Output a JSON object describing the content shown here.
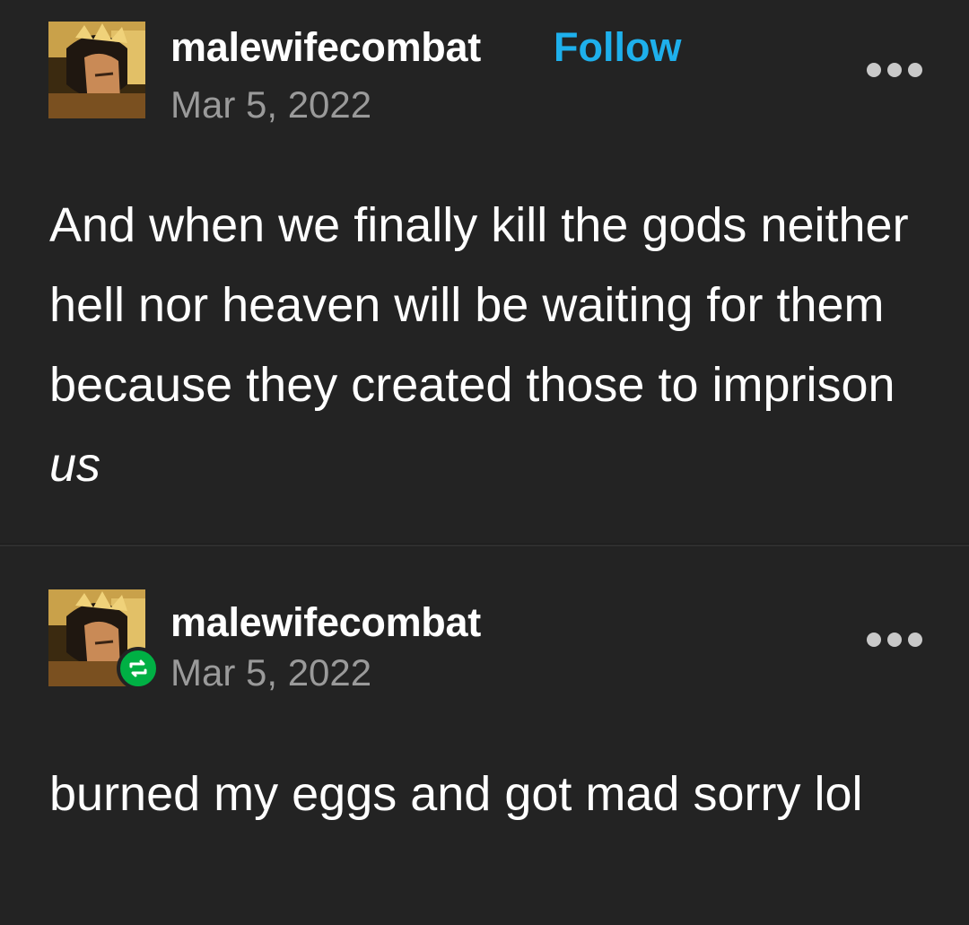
{
  "posts": [
    {
      "username": "malewifecombat",
      "follow_label": "Follow",
      "date": "Mar 5, 2022",
      "text_plain": "And when we finally kill the gods neither hell nor heaven will be waiting for them because they created those to imprison",
      "text_emphasis": "us",
      "avatar_icon": "avatar-image",
      "more_icon": "more-options-icon"
    },
    {
      "username": "malewifecombat",
      "date": "Mar 5, 2022",
      "text_plain": "burned my eggs and got mad sorry lol",
      "avatar_icon": "avatar-image",
      "badge_icon": "reblog-icon",
      "more_icon": "more-options-icon"
    }
  ],
  "colors": {
    "background": "#232323",
    "follow": "#1eb0ec",
    "reblog_badge": "#00b044",
    "date": "#9a9a9a"
  }
}
